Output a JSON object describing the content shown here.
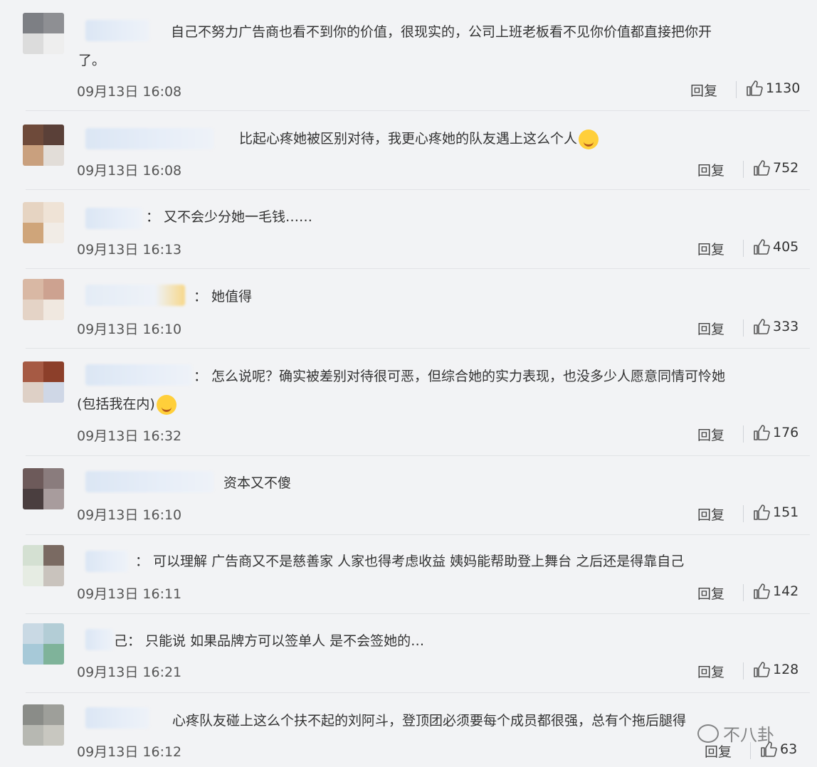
{
  "comments": [
    {
      "text": "自己不努力广告商也看不到你的价值，很现实的，公司上班老板看不见你价值都直接把你开",
      "text2": "了。",
      "time": "09月13日 16:08",
      "reply": "回复",
      "likes": "1130"
    },
    {
      "text": "比起心疼她被区别对待，我更心疼她的队友遇上这么个人",
      "time": "09月13日 16:08",
      "reply": "回复",
      "likes": "752"
    },
    {
      "text": "：  又不会少分她一毛钱……",
      "time": "09月13日 16:13",
      "reply": "回复",
      "likes": "405"
    },
    {
      "text": "：  她值得",
      "time": "09月13日 16:10",
      "reply": "回复",
      "likes": "333"
    },
    {
      "text": "：  怎么说呢？确实被差别对待很可恶，但综合她的实力表现，也没多少人愿意同情可怜她",
      "text2": "(包括我在内)",
      "time": "09月13日 16:32",
      "reply": "回复",
      "likes": "176"
    },
    {
      "text": "资本又不傻",
      "time": "09月13日 16:10",
      "reply": "回复",
      "likes": "151"
    },
    {
      "text": "：  可以理解 广告商又不是慈善家 人家也得考虑收益 姨妈能帮助登上舞台 之后还是得靠自己",
      "time": "09月13日 16:11",
      "reply": "回复",
      "likes": "142"
    },
    {
      "text": "己：  只能说 如果品牌方可以签单人 是不会签她的…",
      "time": "09月13日 16:21",
      "reply": "回复",
      "likes": "128"
    },
    {
      "text": "心疼队友碰上这么个扶不起的刘阿斗，登顶团必须要每个成员都很强，总有个拖后腿得",
      "time": "09月13日 16:12",
      "reply": "回复",
      "likes": "63"
    }
  ],
  "watermark": "不八卦"
}
